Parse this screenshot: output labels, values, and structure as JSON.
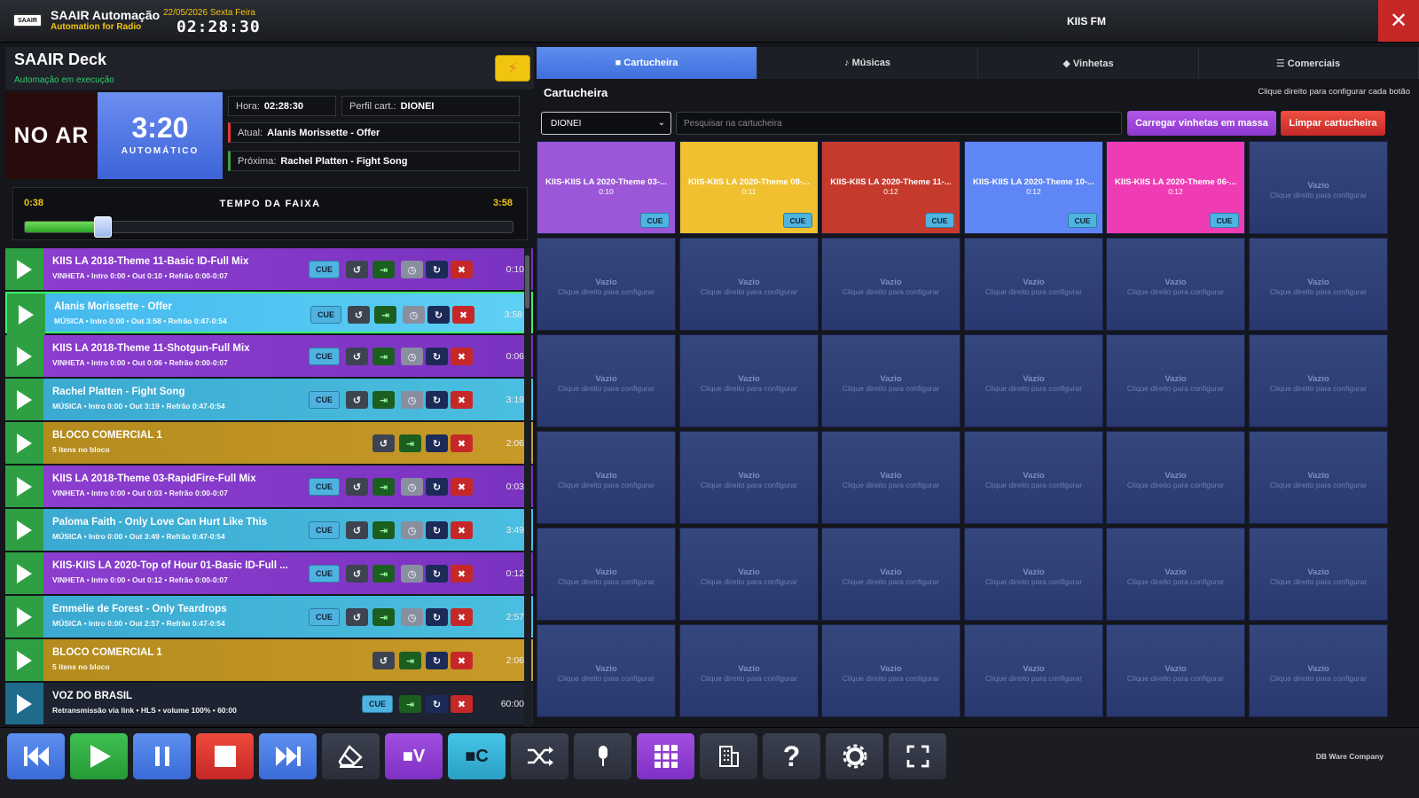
{
  "header": {
    "logo_text": "SAAIR",
    "app_name": "SAAIR Automação",
    "app_sub": "Automation for Radio",
    "date": "22/05/2026 Sexta Feira",
    "clock": "02:28:30",
    "station": "KIIS FM",
    "close_glyph": "✕"
  },
  "deck": {
    "title": "SAAIR Deck",
    "status": "Automação em execução",
    "bolt_glyph": "⚡",
    "on_air": "NO AR",
    "remaining": "3:20",
    "mode": "AUTOMÁTICO",
    "hora_label": "Hora:",
    "hora": "02:28:30",
    "perfil_label": "Perfil cart.:",
    "perfil": "DIONEI",
    "atual_label": "Atual:",
    "atual": "Alanis Morissette - Offer",
    "proxima_label": "Próxima:",
    "proxima": "Rachel Platten - Fight Song",
    "elapsed": "0:38",
    "progress_title": "TEMPO DA FAIXA",
    "total": "3:58",
    "progress_fraction": 0.16
  },
  "playlist": [
    {
      "title": "KIIS LA 2018-Theme 11-Basic ID-Full Mix",
      "meta": "VINHETA • Intro 0:00 • Out 0:10 • Refrão 0:00-0:07",
      "duration": "0:10",
      "kind": "vin"
    },
    {
      "title": "Alanis Morissette - Offer",
      "meta": "MÚSICA • Intro 0:00 • Out 3:58 • Refrão 0:47-0:54",
      "duration": "3:58",
      "kind": "active"
    },
    {
      "title": "KIIS LA 2018-Theme 11-Shotgun-Full Mix",
      "meta": "VINHETA • Intro 0:00 • Out 0:06 • Refrão 0:00-0:07",
      "duration": "0:06",
      "kind": "vin"
    },
    {
      "title": "Rachel Platten - Fight Song",
      "meta": "MÚSICA • Intro 0:00 • Out 3:19 • Refrão 0:47-0:54",
      "duration": "3:19",
      "kind": "mus"
    },
    {
      "title": "BLOCO COMERCIAL 1",
      "meta": "5 itens no bloco",
      "duration": "2:06",
      "kind": "com"
    },
    {
      "title": "KIIS LA 2018-Theme 03-RapidFire-Full Mix",
      "meta": "VINHETA • Intro 0:00 • Out 0:03 • Refrão 0:00-0:07",
      "duration": "0:03",
      "kind": "vin"
    },
    {
      "title": "Paloma Faith - Only Love Can Hurt Like This",
      "meta": "MÚSICA • Intro 0:00 • Out 3:49 • Refrão 0:47-0:54",
      "duration": "3:49",
      "kind": "mus"
    },
    {
      "title": "KIIS-KIIS LA 2020-Top of Hour 01-Basic ID-Full ...",
      "meta": "VINHETA • Intro 0:00 • Out 0:12 • Refrão 0:00-0:07",
      "duration": "0:12",
      "kind": "vin"
    },
    {
      "title": "Emmelie de Forest - Only Teardrops",
      "meta": "MÚSICA • Intro 0:00 • Out 2:57 • Refrão 0:47-0:54",
      "duration": "2:57",
      "kind": "mus"
    },
    {
      "title": "BLOCO COMERCIAL 1",
      "meta": "5 itens no bloco",
      "duration": "2:06",
      "kind": "com"
    },
    {
      "title": "VOZ DO BRASIL",
      "meta": "Retransmissão via link • HLS • volume 100% • 60:00",
      "duration": "60:00",
      "kind": "voz"
    }
  ],
  "row_buttons": {
    "cue": "CUE",
    "reload": "↺",
    "jump": "⇥",
    "clock": "◷",
    "loop": "↻",
    "remove": "✖"
  },
  "tabs": [
    "■ Cartucheira",
    "♪ Músicas",
    "◆ Vinhetas",
    "☰ Comerciais"
  ],
  "cart": {
    "title": "Cartucheira",
    "hint": "Clique direito para configurar cada botão",
    "profile": "DIONEI",
    "search_placeholder": "Pesquisar na cartucheira",
    "mass_button": "Carregar vinhetas em massa",
    "clear_button": "Limpar cartucheira",
    "empty_title": "Vazio",
    "empty_sub": "Clique direito para configurar",
    "cue_label": "CUE",
    "filled": [
      {
        "title": "KIIS-KIIS LA 2020-Theme 03-...",
        "time": "0:10",
        "color": "#9b57d8"
      },
      {
        "title": "KIIS-KIIS LA 2020-Theme 08-...",
        "time": "0:11",
        "color": "#f0c030"
      },
      {
        "title": "KIIS-KIIS LA 2020-Theme 11-...",
        "time": "0:12",
        "color": "#c63a2e"
      },
      {
        "title": "KIIS-KIIS LA 2020-Theme 10-...",
        "time": "0:12",
        "color": "#5f86f5"
      },
      {
        "title": "KIIS-KIIS LA 2020-Theme 06-...",
        "time": "0:12",
        "color": "#f03cb4"
      }
    ]
  },
  "footer": {
    "company": "DB Ware Company"
  },
  "colors": {
    "accent_blue": "#3f6fdc",
    "on_air_bg": "#2a0b0b",
    "play_green": "#2ea043",
    "danger": "#c62828"
  }
}
